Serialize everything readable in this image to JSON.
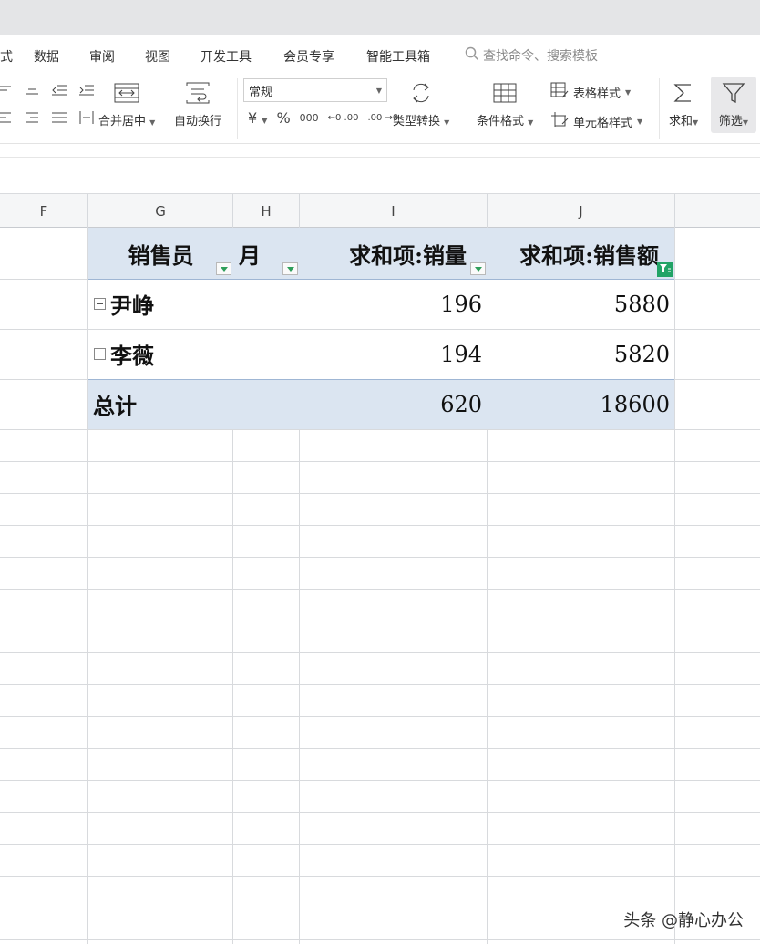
{
  "menu": {
    "partial_tab": "式",
    "tabs": [
      "数据",
      "审阅",
      "视图",
      "开发工具",
      "会员专享",
      "智能工具箱"
    ],
    "search_placeholder": "查找命令、搜索模板"
  },
  "ribbon": {
    "merge_center": "合并居中",
    "wrap_text": "自动换行",
    "number_format": "常规",
    "currency_symbol": "¥",
    "percent_symbol": "%",
    "thousands_symbol": "000",
    "inc_decimal": "←0 .00",
    "dec_decimal": ".00 →0",
    "type_convert": "类型转换",
    "conditional_format": "条件格式",
    "table_style": "表格样式",
    "cell_style": "单元格样式",
    "sum": "求和",
    "filter": "筛选"
  },
  "columns": [
    "F",
    "G",
    "H",
    "I",
    "J"
  ],
  "pivot": {
    "headers": {
      "salesperson": "销售员",
      "month": "月",
      "sum_qty": "求和项:销量",
      "sum_amount": "求和项:销售额"
    },
    "rows": [
      {
        "name": "尹峥",
        "qty": "196",
        "amount": "5880"
      },
      {
        "name": "李薇",
        "qty": "194",
        "amount": "5820"
      }
    ],
    "total": {
      "label": "总计",
      "qty": "620",
      "amount": "18600"
    }
  },
  "watermark": "头条 @静心办公"
}
